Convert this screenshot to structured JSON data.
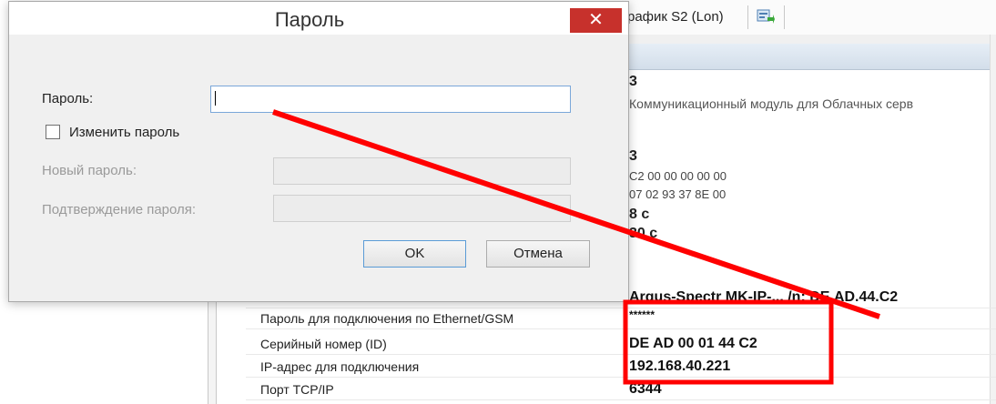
{
  "background": {
    "toolbar_label": "рафик S2 (Lon)",
    "toolbar_icon": "export-icon",
    "values": [
      {
        "text": "3",
        "style": "bold"
      },
      {
        "text": "Коммуникационный модуль для Облачных серв",
        "style": "desc"
      },
      {
        "text": "3",
        "style": "bold"
      },
      {
        "text": "C2 00 00 00 00 00",
        "style": "gray"
      },
      {
        "text": "07 02 93 37 8E 00",
        "style": "gray"
      },
      {
        "text": "8 с",
        "style": "bold"
      },
      {
        "text": "30 с",
        "style": "bold"
      }
    ],
    "grid_rows": [
      {
        "label": "",
        "value": "Argus-Spectr MK-IP-... /n: DE.AD.44.C2",
        "style": "bold"
      },
      {
        "label": "Пароль для подключения по Ethernet/GSM",
        "value": "******",
        "style": "pw"
      },
      {
        "label": "Серийный номер (ID)",
        "value": "DE AD 00 01 44 C2",
        "style": "bold"
      },
      {
        "label": "IP-адрес для подключения",
        "value": "192.168.40.221",
        "style": "bold"
      },
      {
        "label": "Порт TCP/IP",
        "value": "6344",
        "style": "bold"
      }
    ]
  },
  "dialog": {
    "title": "Пароль",
    "close_glyph": "✕",
    "password_label": "Пароль:",
    "password_value": "",
    "change_password_label": "Изменить пароль",
    "change_password_checked": false,
    "new_password_label": "Новый пароль:",
    "confirm_password_label": "Подтверждение пароля:",
    "ok_label": "OK",
    "cancel_label": "Отмена"
  },
  "colors": {
    "annotation": "#ff0000",
    "close_button": "#c7312c",
    "focus_border": "#7aa7d9"
  }
}
